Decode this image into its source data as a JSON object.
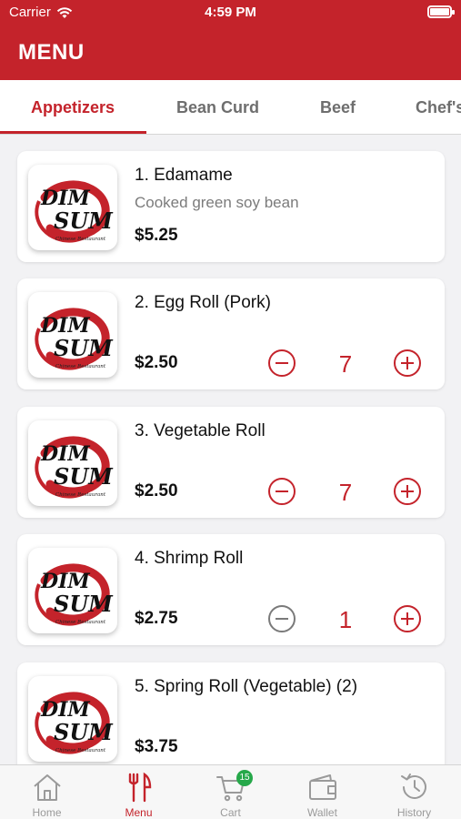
{
  "status_bar": {
    "carrier": "Carrier",
    "time": "4:59 PM"
  },
  "header": {
    "title": "MENU"
  },
  "tabs": [
    {
      "label": "Appetizers",
      "active": true
    },
    {
      "label": "Bean Curd",
      "active": false
    },
    {
      "label": "Beef",
      "active": false
    },
    {
      "label": "Chef's",
      "active": false
    }
  ],
  "logo": {
    "text_line1": "DIM",
    "text_line2": "SUM",
    "subtitle": "Chinese Restaurant"
  },
  "items": [
    {
      "name": "1. Edamame",
      "description": "Cooked green soy bean",
      "price": "$5.25"
    },
    {
      "name": "2. Egg Roll (Pork)",
      "price": "$2.50",
      "quantity": "7"
    },
    {
      "name": "3. Vegetable Roll",
      "price": "$2.50",
      "quantity": "7"
    },
    {
      "name": "4. Shrimp Roll",
      "price": "$2.75",
      "quantity": "1"
    },
    {
      "name": "5. Spring Roll (Vegetable) (2)",
      "price": "$3.75"
    }
  ],
  "bottom_nav": [
    {
      "label": "Home",
      "icon": "home-icon",
      "active": false
    },
    {
      "label": "Menu",
      "icon": "fork-knife-icon",
      "active": true
    },
    {
      "label": "Cart",
      "icon": "cart-icon",
      "active": false,
      "badge": "15"
    },
    {
      "label": "Wallet",
      "icon": "wallet-icon",
      "active": false
    },
    {
      "label": "History",
      "icon": "history-icon",
      "active": false
    }
  ],
  "colors": {
    "brand": "#c4232b",
    "badge": "#26a84a",
    "inactive": "#9a9a9a"
  }
}
